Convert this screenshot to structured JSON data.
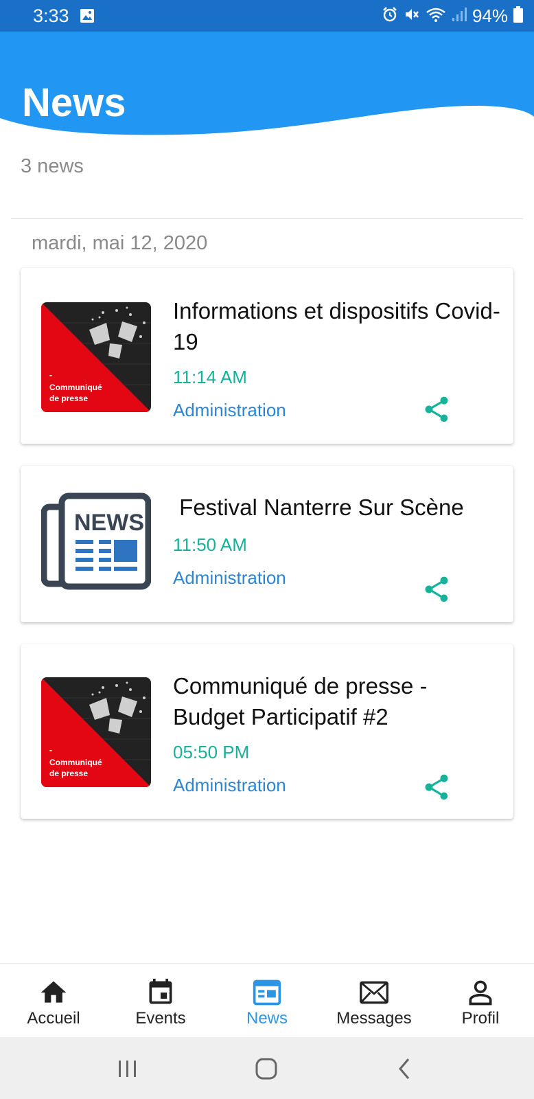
{
  "status_bar": {
    "time": "3:33",
    "battery": "94%",
    "icons": [
      "image-icon",
      "alarm-icon",
      "mute-icon",
      "wifi-icon",
      "signal-icon",
      "battery-icon"
    ]
  },
  "header": {
    "title": "News"
  },
  "news_count": "3 news",
  "date_header": "mardi, mai 12, 2020",
  "news_items": [
    {
      "title": "Informations et dispositifs Covid-19",
      "time": "11:14 AM",
      "author": "Administration",
      "thumb_text_1": "-",
      "thumb_text_2": "Communiqué",
      "thumb_text_3": "de presse"
    },
    {
      "title": " Festival Nanterre Sur Scène",
      "time": "11:50 AM",
      "author": "Administration",
      "thumb_text_1": "NEWS"
    },
    {
      "title": "Communiqué de presse - Budget Participatif #2",
      "time": "05:50 PM",
      "author": "Administration",
      "thumb_text_1": "-",
      "thumb_text_2": "Communiqué",
      "thumb_text_3": "de presse"
    }
  ],
  "bottom_nav": [
    {
      "label": "Accueil",
      "icon": "home-icon"
    },
    {
      "label": "Events",
      "icon": "calendar-icon"
    },
    {
      "label": "News",
      "icon": "news-icon",
      "active": true
    },
    {
      "label": "Messages",
      "icon": "envelope-icon"
    },
    {
      "label": "Profil",
      "icon": "person-icon"
    }
  ],
  "colors": {
    "primary": "#2196f3",
    "status_bar": "#1a6fc7",
    "time_text": "#16b39a",
    "author_text": "#2b86d6",
    "share_icon": "#16b39a",
    "thumb_red": "#e30613"
  }
}
